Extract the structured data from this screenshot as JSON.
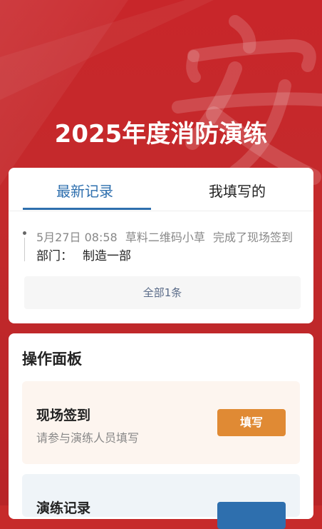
{
  "hero": {
    "title": "2025年度消防演练",
    "watermark_char": "安"
  },
  "records": {
    "tabs": [
      "最新记录",
      "我填写的"
    ],
    "active_tab": 0,
    "items": [
      {
        "time": "5月27日 08:58",
        "user": "草料二维码小草",
        "action": "完成了现场签到",
        "dept_label": "部门：",
        "dept_value": "制造一部"
      }
    ],
    "all_label": "全部1条"
  },
  "panel": {
    "title": "操作面板",
    "actions": [
      {
        "name": "现场签到",
        "desc": "请参与演练人员填写",
        "button": "填写"
      },
      {
        "name": "演练记录"
      }
    ]
  },
  "colors": {
    "brand_red": "#c8262a",
    "accent_blue": "#2e6fae",
    "accent_orange": "#e08a34"
  }
}
